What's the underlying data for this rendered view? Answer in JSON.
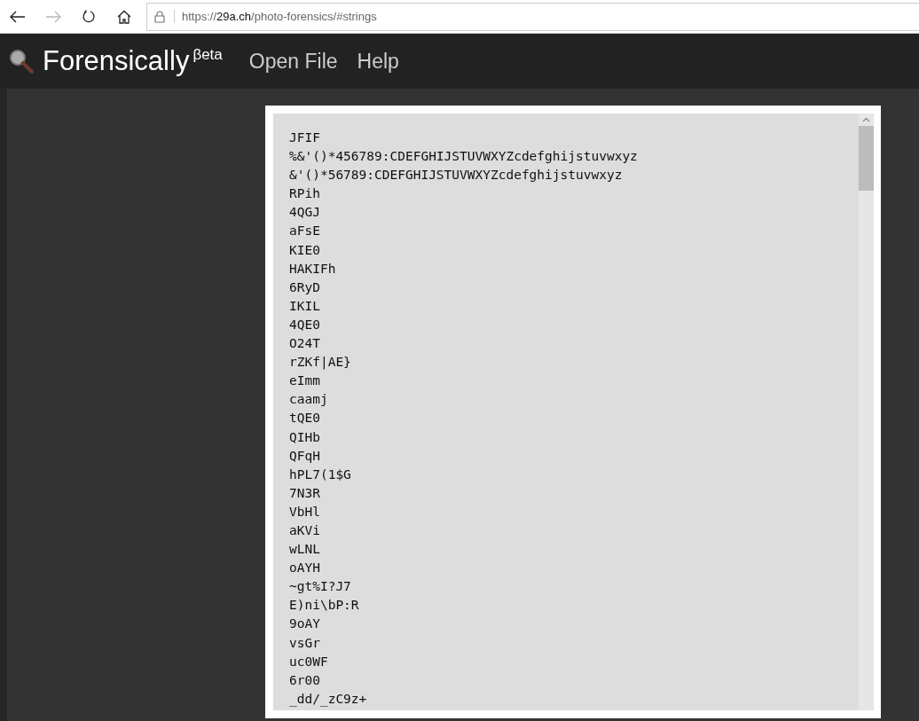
{
  "browser": {
    "back_disabled": false,
    "forward_disabled": true,
    "url": {
      "scheme": "https://",
      "host": "29a.ch",
      "path": "/photo-forensics/#strings"
    }
  },
  "header": {
    "title": "Forensically",
    "superscript": "βeta",
    "menu": [
      {
        "label": "Open File"
      },
      {
        "label": "Help"
      }
    ]
  },
  "strings": [
    "JFIF",
    "%&'()*456789:CDEFGHIJSTUVWXYZcdefghijstuvwxyz",
    "&'()*56789:CDEFGHIJSTUVWXYZcdefghijstuvwxyz",
    "RPih",
    "4QGJ",
    "aFsE",
    "KIE0",
    "HAKIFh",
    "6RyD",
    "IKIL",
    "4QE0",
    "O24T",
    "rZKf|AE}",
    "eImm",
    "caamj",
    "tQE0",
    "QIHb",
    "QFqH",
    "hPL7(1$G",
    "7N3R",
    "VbHl",
    "aKVi",
    "wLNL",
    "oAYH",
    "~gt%I?J7",
    "E)ni\\bP:R",
    "9oAY",
    "vsGr",
    "uc0WF",
    "6r00",
    "_dd/_zC9z+"
  ]
}
